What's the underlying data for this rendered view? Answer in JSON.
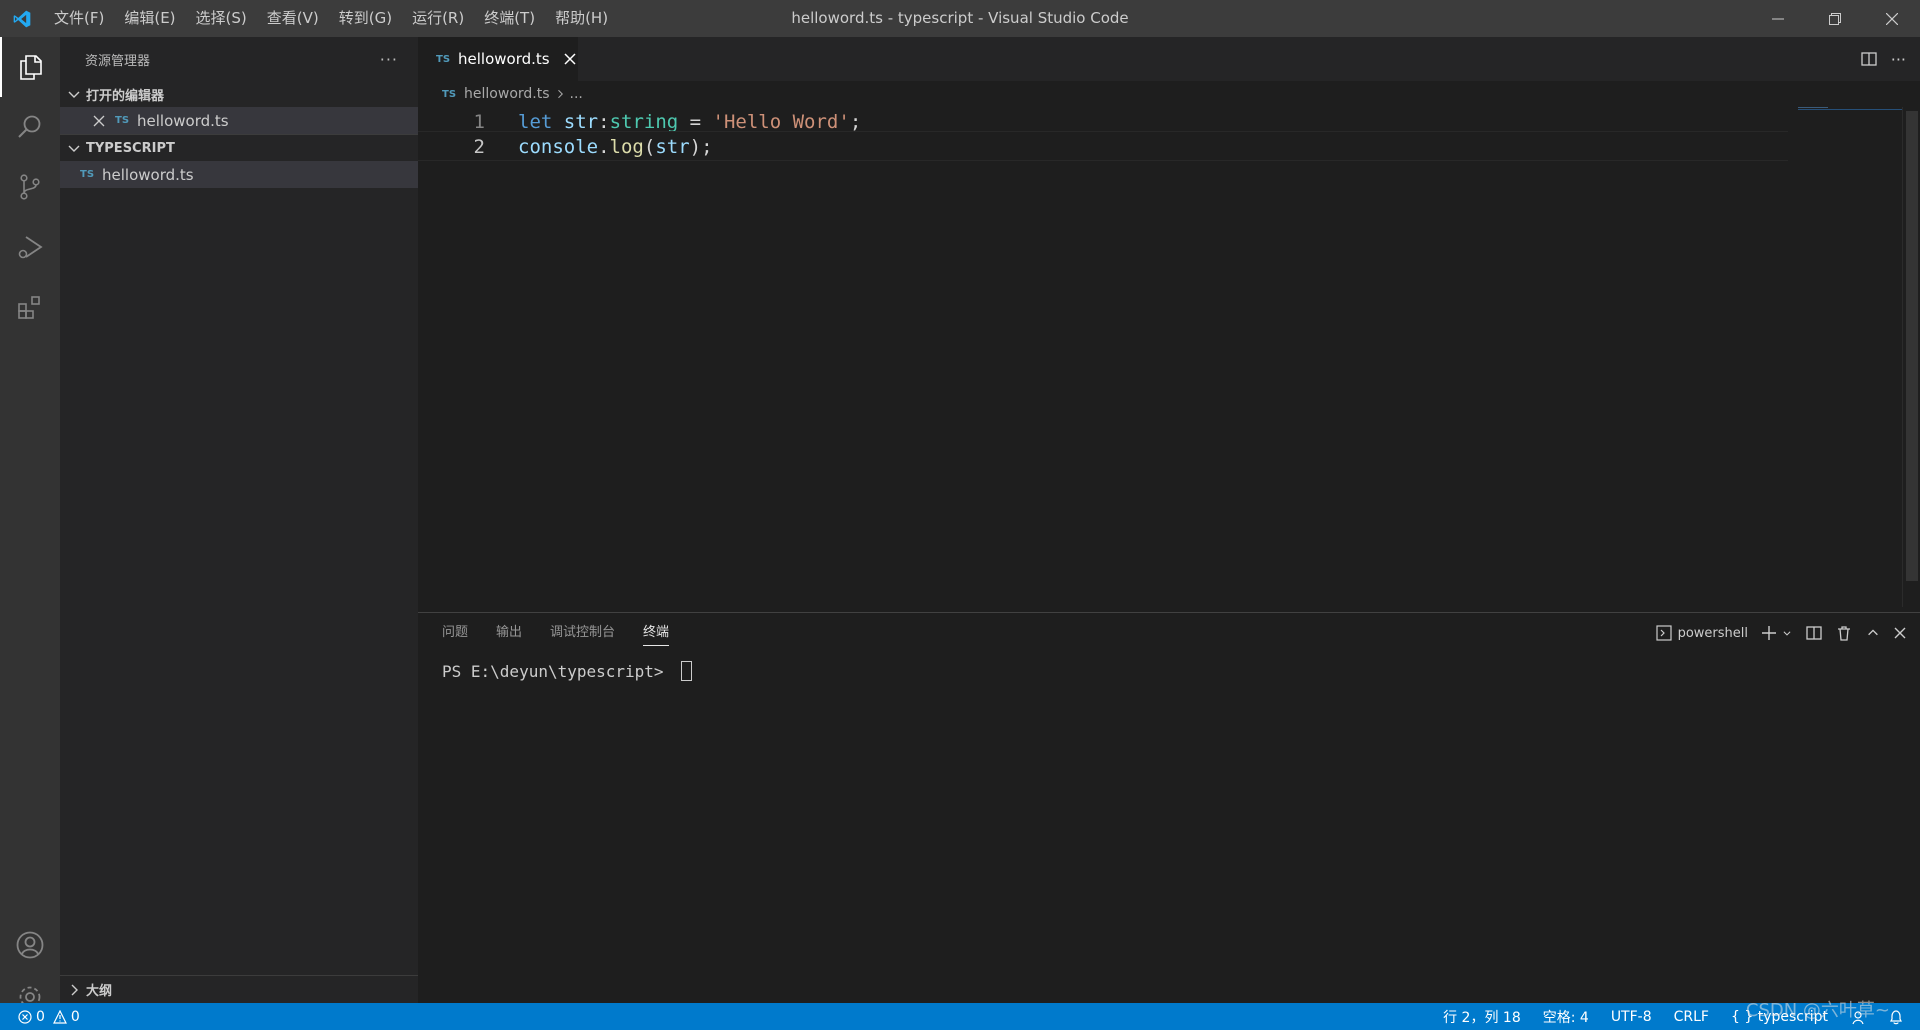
{
  "titlebar": {
    "menu": [
      "文件(F)",
      "编辑(E)",
      "选择(S)",
      "查看(V)",
      "转到(G)",
      "运行(R)",
      "终端(T)",
      "帮助(H)"
    ],
    "title": "helloword.ts - typescript - Visual Studio Code"
  },
  "sidebar": {
    "title": "资源管理器",
    "open_editors_label": "打开的编辑器",
    "open_editor_file": "helloword.ts",
    "workspace_label": "TYPESCRIPT",
    "workspace_file": "helloword.ts",
    "outline_label": "大纲",
    "ts_badge": "TS"
  },
  "editor": {
    "tab_label": "helloword.ts",
    "breadcrumb_file": "helloword.ts",
    "breadcrumb_more": "...",
    "line_numbers": [
      "1",
      "2"
    ],
    "code": {
      "line1": {
        "kw": "let",
        "var": "str",
        "colon": ":",
        "type": "string",
        "eq": " = ",
        "str": "'Hello Word'",
        "semi": ";"
      },
      "line2": {
        "obj": "console",
        "dot": ".",
        "fn": "log",
        "open": "(",
        "arg": "str",
        "close": ");"
      }
    }
  },
  "panel": {
    "tabs": [
      "问题",
      "输出",
      "调试控制台",
      "终端"
    ],
    "active_tab": "终端",
    "terminal_name": "powershell",
    "prompt": "PS E:\\deyun\\typescript> "
  },
  "statusbar": {
    "errors": "0",
    "warnings": "0",
    "position": "行 2，列 18",
    "spaces": "空格: 4",
    "encoding": "UTF-8",
    "eol": "CRLF",
    "language": "typescript"
  },
  "watermark": "CSDN @六叶草~",
  "colors": {
    "accent": "#007acc",
    "keyword": "#569cd6",
    "string": "#ce9178",
    "type": "#4ec9b0"
  }
}
